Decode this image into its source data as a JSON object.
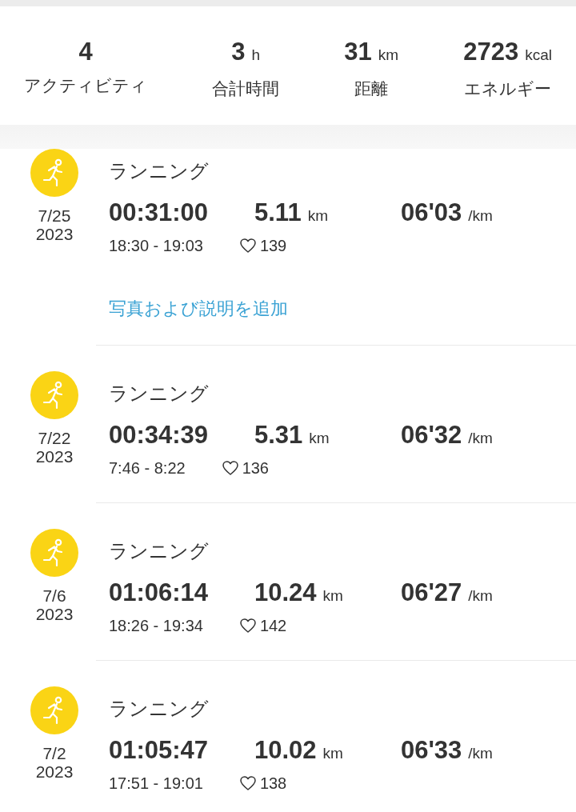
{
  "summary": [
    {
      "value": "4",
      "label": "アクティビティ"
    },
    {
      "value": "3",
      "unit": "h",
      "label": "合計時間"
    },
    {
      "value": "31",
      "unit": "km",
      "label": "距離"
    },
    {
      "value": "2723",
      "unit": "kcal",
      "label": "エネルギー"
    }
  ],
  "activities": [
    {
      "date": "7/25",
      "year": "2023",
      "title": "ランニング",
      "duration": "00:31:00",
      "distance": "5.11",
      "distance_unit": "km",
      "pace": "06'03",
      "pace_unit": "/km",
      "time_range": "18:30 - 19:03",
      "heart_rate": "139",
      "link": "写真および説明を追加"
    },
    {
      "date": "7/22",
      "year": "2023",
      "title": "ランニング",
      "duration": "00:34:39",
      "distance": "5.31",
      "distance_unit": "km",
      "pace": "06'32",
      "pace_unit": "/km",
      "time_range": "7:46 - 8:22",
      "heart_rate": "136"
    },
    {
      "date": "7/6",
      "year": "2023",
      "title": "ランニング",
      "duration": "01:06:14",
      "distance": "10.24",
      "distance_unit": "km",
      "pace": "06'27",
      "pace_unit": "/km",
      "time_range": "18:26 - 19:34",
      "heart_rate": "142"
    },
    {
      "date": "7/2",
      "year": "2023",
      "title": "ランニング",
      "duration": "01:05:47",
      "distance": "10.02",
      "distance_unit": "km",
      "pace": "06'33",
      "pace_unit": "/km",
      "time_range": "17:51 - 19:01",
      "heart_rate": "138"
    }
  ]
}
